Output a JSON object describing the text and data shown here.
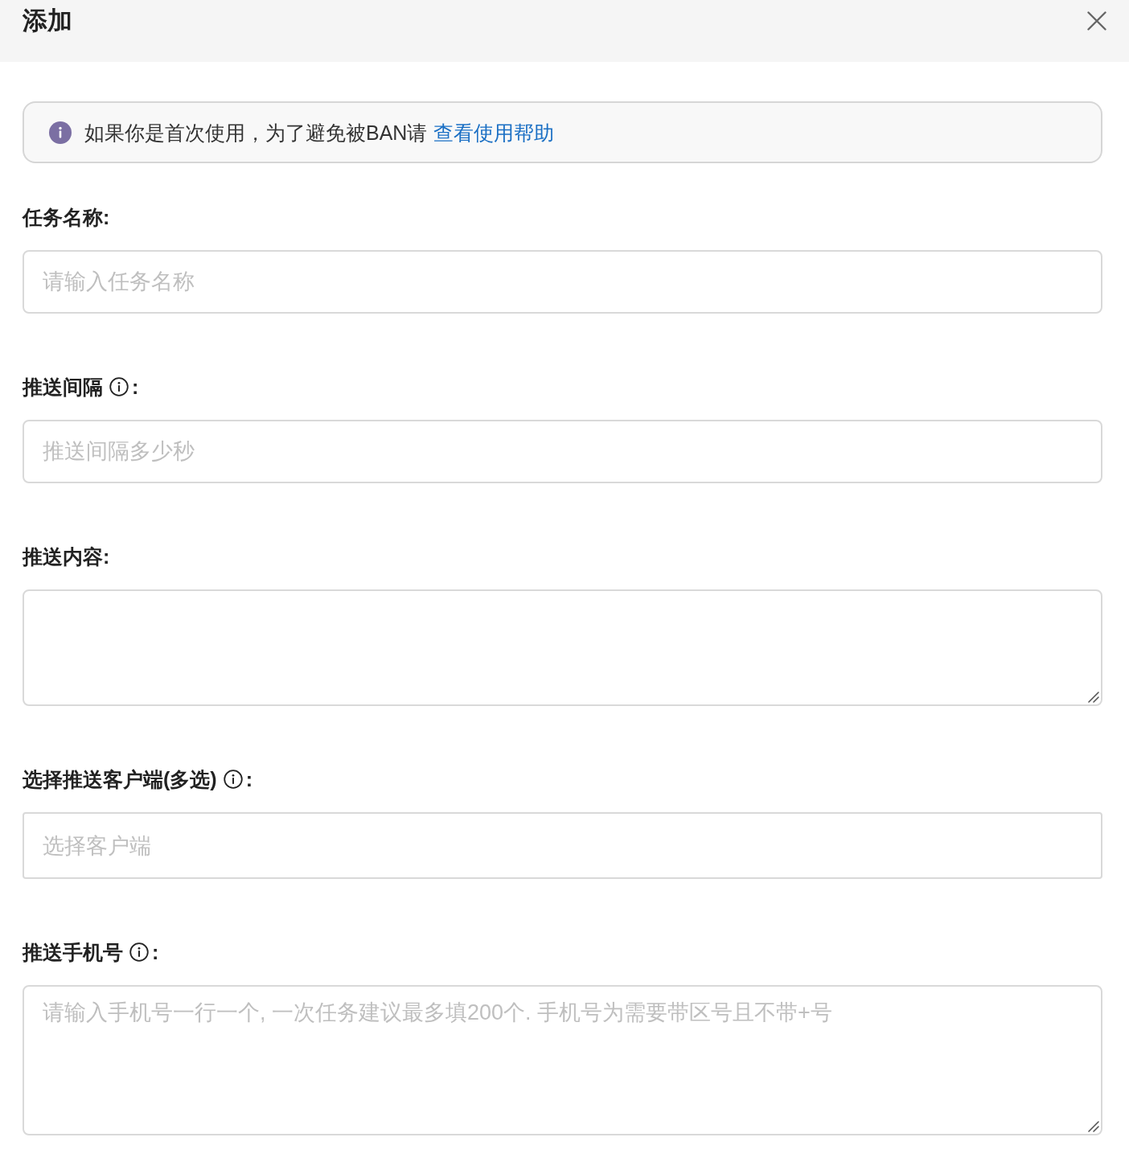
{
  "dialog": {
    "title": "添加"
  },
  "notice": {
    "text": "如果你是首次使用，为了避免被BAN请",
    "link": "查看使用帮助"
  },
  "fields": [
    {
      "kind": "input",
      "label": "任务名称",
      "info": false,
      "colon": ":",
      "placeholder": "请输入任务名称"
    },
    {
      "kind": "input",
      "label": "推送间隔",
      "info": true,
      "colon": ":",
      "placeholder": "推送间隔多少秒"
    },
    {
      "kind": "textarea",
      "label": "推送内容",
      "info": false,
      "colon": ":"
    },
    {
      "kind": "select",
      "label": "选择推送客户端(多选)",
      "info": true,
      "colon": ":",
      "placeholder": "选择客户端"
    },
    {
      "kind": "textarea",
      "label": "推送手机号",
      "info": true,
      "colon": ":",
      "placeholder": "请输入手机号一行一个, 一次任务建议最多填200个. 手机号为需要带区号且不带+号"
    }
  ]
}
